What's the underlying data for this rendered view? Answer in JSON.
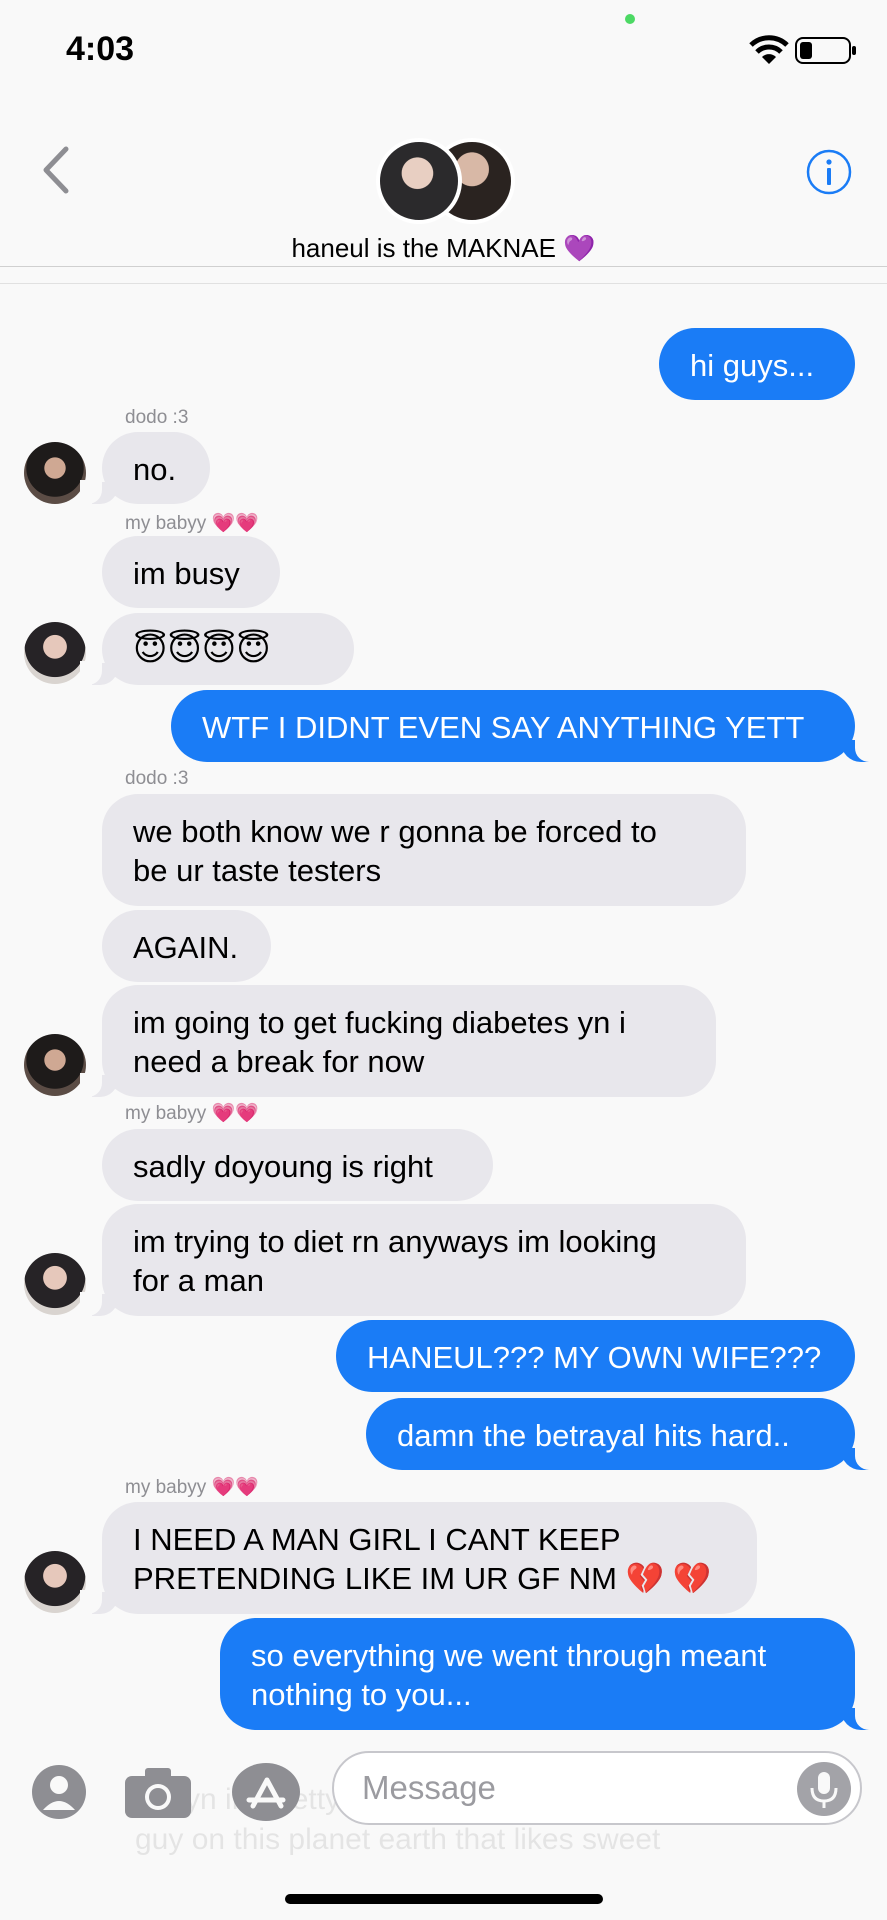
{
  "status_bar": {
    "time": "4:03"
  },
  "header": {
    "group_name": "haneul is the MAKNAE 💜",
    "back_icon": "chevron-left-icon",
    "info_icon": "info-icon"
  },
  "messages": [
    {
      "dir": "out",
      "text": "hi guys..."
    },
    {
      "sender": "dodo :3"
    },
    {
      "dir": "in",
      "text": "no."
    },
    {
      "sender": "my babyy 💗💗"
    },
    {
      "dir": "in",
      "text": "im busy"
    },
    {
      "dir": "in",
      "text": "😇😇😇😇"
    },
    {
      "dir": "out",
      "text": "WTF I DIDNT EVEN SAY ANYTHING YETT"
    },
    {
      "sender": "dodo :3"
    },
    {
      "dir": "in",
      "text": "we both know we r gonna be forced to\nbe ur taste testers"
    },
    {
      "dir": "in",
      "text": "AGAIN."
    },
    {
      "dir": "in",
      "text": "im going to get fucking diabetes yn i\nneed a break for now"
    },
    {
      "sender": "my babyy 💗💗"
    },
    {
      "dir": "in",
      "text": "sadly doyoung is right"
    },
    {
      "dir": "in",
      "text": "im trying to diet rn anyways im looking\nfor a man"
    },
    {
      "dir": "out",
      "text": "HANEUL??? MY OWN WIFE???"
    },
    {
      "dir": "out",
      "text": "damn the betrayal hits hard.."
    },
    {
      "sender": "my babyy 💗💗"
    },
    {
      "dir": "in",
      "text": "I NEED A MAN GIRL I CANT KEEP\nPRETENDING LIKE IM UR GF NM 💔 💔"
    },
    {
      "dir": "out",
      "text": "so everything we went through meant\nnothing to you..."
    }
  ],
  "input_bar": {
    "placeholder": "Message",
    "ghost_text": "but yn im pretty sure you can find any\nguy on this planet earth that likes sweet"
  },
  "colors": {
    "outgoing_bubble": "#1a7cf6",
    "incoming_bubble": "#e8e7ec",
    "info_accent": "#1a7cf6"
  }
}
